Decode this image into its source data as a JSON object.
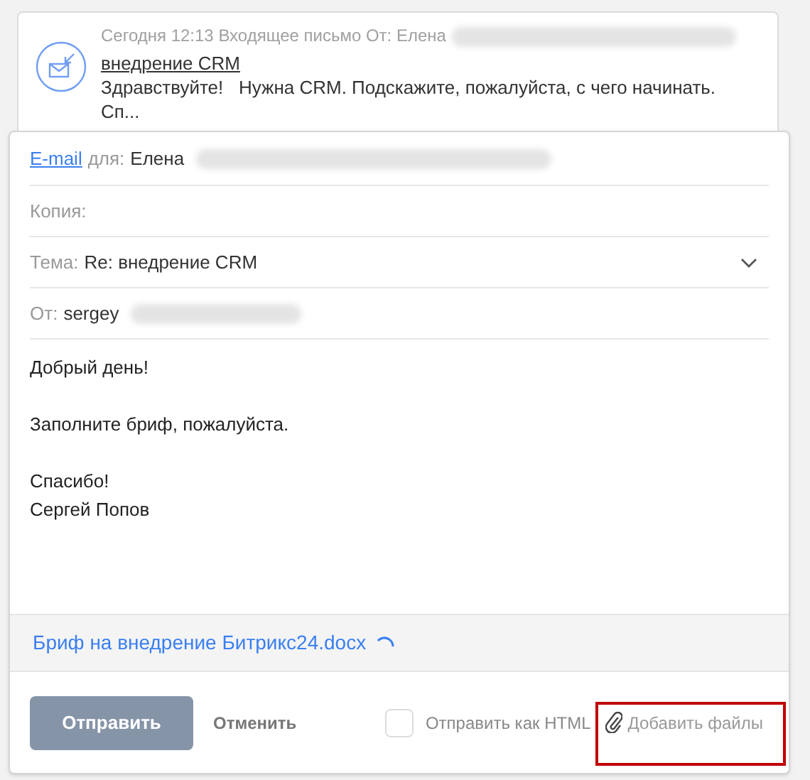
{
  "incoming": {
    "meta": "Сегодня 12:13 Входящее письмо От: Елена",
    "subject": "внедрение CRM",
    "preview": "Здравствуйте!   Нужна CRM. Подскажите, пожалуйста, с чего начинать. Сп..."
  },
  "compose": {
    "to": {
      "link": "E-mail",
      "label": "для:",
      "value": "Елена"
    },
    "cc": {
      "label": "Копия:"
    },
    "subject": {
      "label": "Тема:",
      "value": "Re: внедрение CRM"
    },
    "from": {
      "label": "От:",
      "value": "sergey"
    },
    "body": [
      [
        "Добрый день!"
      ],
      [
        "Заполните бриф, пожалуйста."
      ],
      [
        "Спасибо!",
        "Сергей Попов"
      ]
    ],
    "attachment": {
      "name": "Бриф на внедрение Битрикс24.docx",
      "loading": true
    },
    "buttons": {
      "send": "Отправить",
      "cancel": "Отменить"
    },
    "html_option": {
      "label": "Отправить как HTML",
      "checked": false
    },
    "add_files": {
      "label": "Добавить файлы",
      "highlighted": true
    }
  }
}
